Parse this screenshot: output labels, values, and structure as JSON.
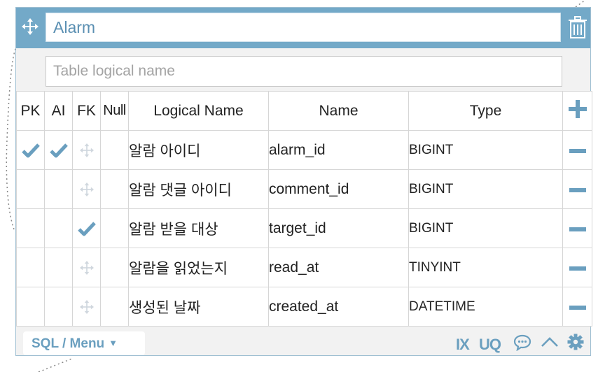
{
  "table": {
    "name": "Alarm",
    "logical_name_value": "",
    "logical_name_placeholder": "Table logical name"
  },
  "headers": {
    "pk": "PK",
    "ai": "AI",
    "fk": "FK",
    "null": "Null",
    "logical_name": "Logical Name",
    "name": "Name",
    "type": "Type"
  },
  "rows": [
    {
      "logical_name": "알람 아이디",
      "name": "alarm_id",
      "type": "BIGINT",
      "pk": true,
      "ai": true,
      "fk": false,
      "null": false
    },
    {
      "logical_name": "알람 댓글 아이디",
      "name": "comment_id",
      "type": "BIGINT",
      "pk": false,
      "ai": false,
      "fk": false,
      "null": false
    },
    {
      "logical_name": "알람 받을 대상",
      "name": "target_id",
      "type": "BIGINT",
      "pk": false,
      "ai": false,
      "fk": true,
      "null": false
    },
    {
      "logical_name": "알람을 읽었는지",
      "name": "read_at",
      "type": "TINYINT",
      "pk": false,
      "ai": false,
      "fk": false,
      "null": false
    },
    {
      "logical_name": "생성된 날짜",
      "name": "created_at",
      "type": "DATETIME",
      "pk": false,
      "ai": false,
      "fk": false,
      "null": false
    }
  ],
  "footer": {
    "sql_menu_label": "SQL / Menu",
    "index_label": "IX",
    "unique_label": "UQ"
  },
  "icons": {
    "move": "move-icon",
    "trash": "trash-icon",
    "add": "plus-icon",
    "remove": "minus-icon",
    "check": "checkmark-icon",
    "fk_drag": "move-icon",
    "comment": "comment-icon",
    "collapse": "chevron-up-icon",
    "settings": "gear-icon"
  },
  "colors": {
    "header_bar": "#73a9c8",
    "accent": "#6a9fbf",
    "title_text": "#5a8fb2",
    "card_background": "#f2f2f2",
    "faint_icon": "#d0d7de"
  }
}
